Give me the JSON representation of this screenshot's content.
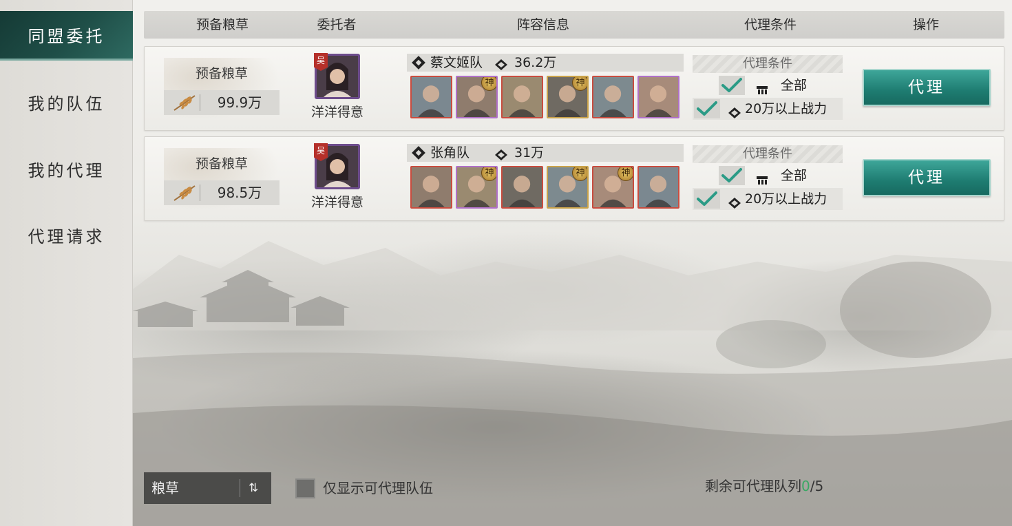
{
  "sidebar": {
    "items": [
      {
        "label": "同盟委托",
        "active": true
      },
      {
        "label": "我的队伍",
        "active": false
      },
      {
        "label": "我的代理",
        "active": false
      },
      {
        "label": "代理请求",
        "active": false
      }
    ]
  },
  "header": {
    "columns": [
      "预备粮草",
      "委托者",
      "阵容信息",
      "代理条件",
      "操作"
    ]
  },
  "rows": [
    {
      "grain_title": "预备粮草",
      "grain_value": "99.9万",
      "requester": {
        "name": "洋洋得意",
        "badge": "吴"
      },
      "team": {
        "name": "蔡文姬队",
        "power": "36.2万"
      },
      "heroes": [
        {
          "name": "helmet-warrior",
          "god": false,
          "frame": "red"
        },
        {
          "name": "lady-hero",
          "god": true,
          "frame": "purple"
        },
        {
          "name": "old-warrior",
          "god": false,
          "frame": "red"
        },
        {
          "name": "archer-lady",
          "god": true,
          "frame": "gold"
        },
        {
          "name": "helmet-warrior",
          "god": false,
          "frame": "red"
        },
        {
          "name": "lady-hero-2",
          "god": false,
          "frame": "purple"
        }
      ],
      "conditions": {
        "title": "代理条件",
        "line1": "全部",
        "line2": "20万以上战力"
      },
      "button": "代理"
    },
    {
      "grain_title": "预备粮草",
      "grain_value": "98.5万",
      "requester": {
        "name": "洋洋得意",
        "badge": "吴"
      },
      "team": {
        "name": "张角队",
        "power": "31万"
      },
      "heroes": [
        {
          "name": "straw-hat-warrior",
          "god": false,
          "frame": "red"
        },
        {
          "name": "bald-warrior",
          "god": true,
          "frame": "purple"
        },
        {
          "name": "straw-hat-warrior",
          "god": false,
          "frame": "red"
        },
        {
          "name": "general-hero",
          "god": true,
          "frame": "gold"
        },
        {
          "name": "bearded-hero",
          "god": true,
          "frame": "red"
        },
        {
          "name": "straw-hat-warrior",
          "god": false,
          "frame": "red"
        }
      ],
      "conditions": {
        "title": "代理条件",
        "line1": "全部",
        "line2": "20万以上战力"
      },
      "button": "代理"
    }
  ],
  "god_badge": "神",
  "bottom": {
    "sort_label": "粮草",
    "sort_icon": "⇅",
    "filter_label": "仅显示可代理队伍",
    "remaining_prefix": "剩余可代理队列",
    "remaining_used": "0",
    "remaining_total": "/5"
  },
  "colors": {
    "accent_teal": "#1e7c71",
    "sidebar_active": "#1f4f48",
    "green_text": "#3aa864"
  }
}
